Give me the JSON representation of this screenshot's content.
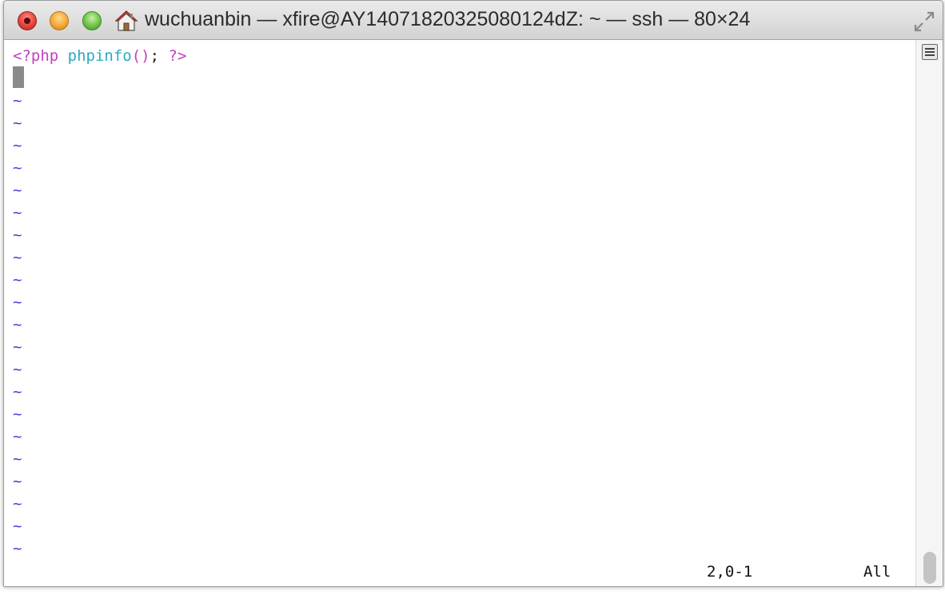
{
  "window": {
    "title": "wuchuanbin — xfire@AY14071820325080124dZ: ~ — ssh — 80×24"
  },
  "editor": {
    "code_line": {
      "open_tag": "<?php",
      "space1": " ",
      "func_name": "phpinfo",
      "parens": "()",
      "semicolon": ";",
      "space2": " ",
      "close_tag": "?>"
    },
    "empty_line_marker": "~",
    "status": {
      "position": "2,0-1",
      "scroll": "All"
    }
  },
  "colors": {
    "php_tag": "#c43fbd",
    "function": "#2ea8c0",
    "tilde": "#3f3fd6"
  }
}
